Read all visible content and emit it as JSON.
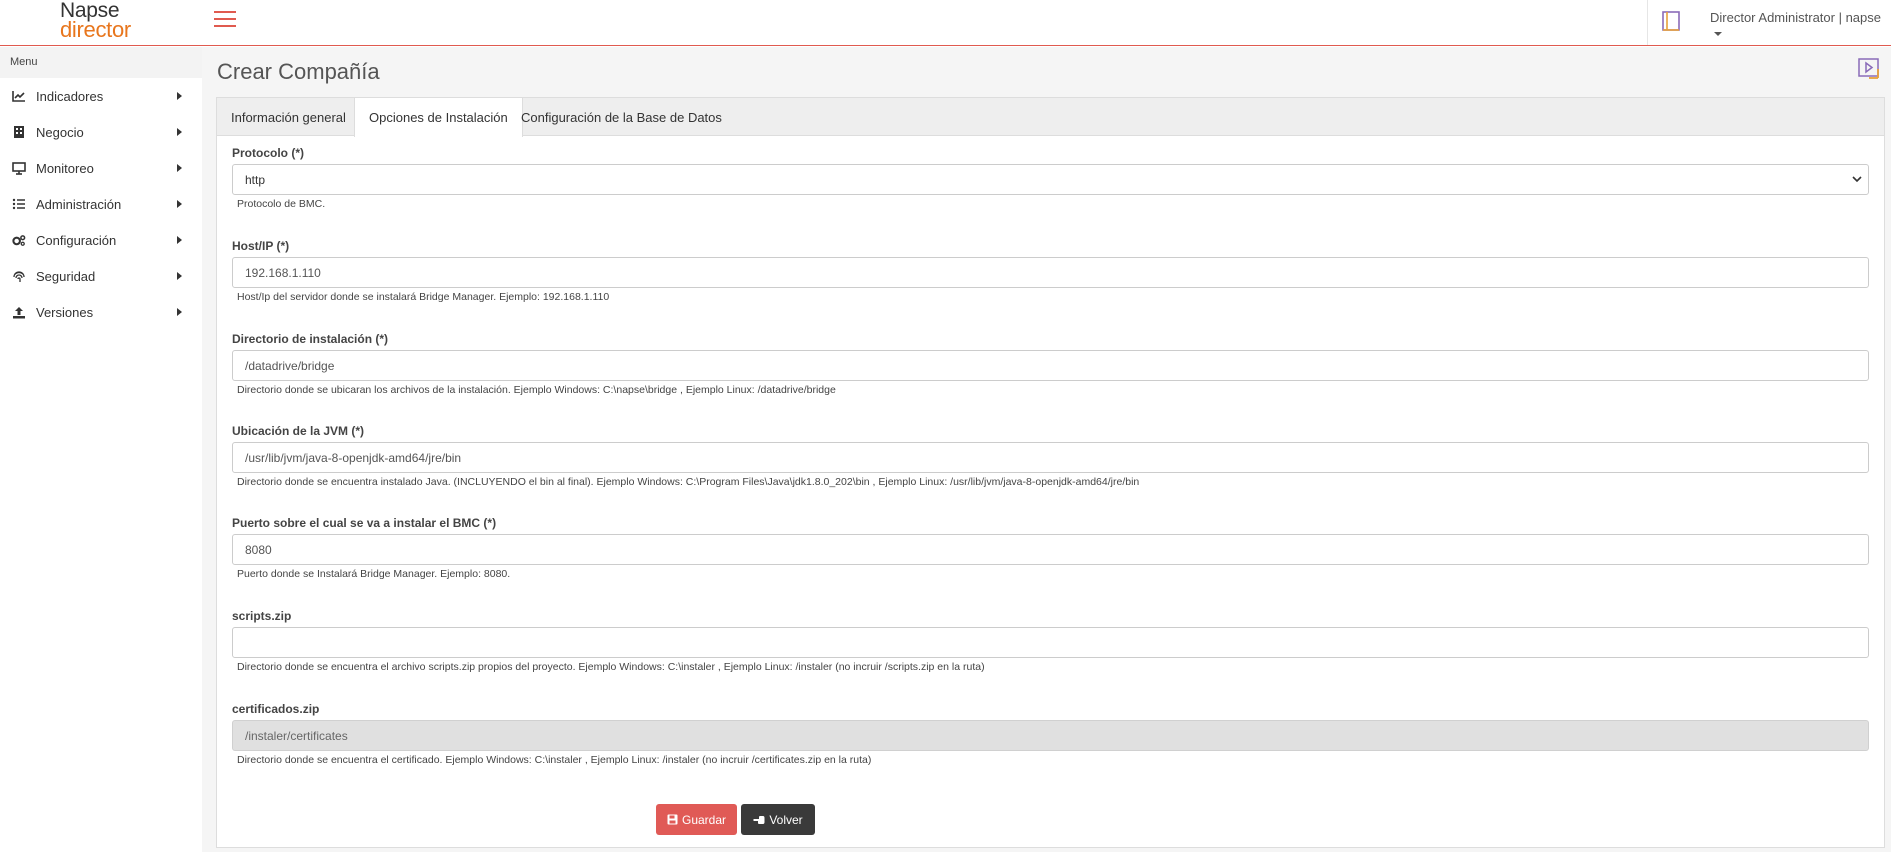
{
  "header": {
    "logo_line1": "Napse",
    "logo_line2": "director",
    "user": "Director Administrator | napse"
  },
  "sidebar": {
    "title": "Menu",
    "items": [
      {
        "label": "Indicadores",
        "icon": "chart-line-icon"
      },
      {
        "label": "Negocio",
        "icon": "building-icon"
      },
      {
        "label": "Monitoreo",
        "icon": "monitor-icon"
      },
      {
        "label": "Administración",
        "icon": "list-icon"
      },
      {
        "label": "Configuración",
        "icon": "cogs-icon"
      },
      {
        "label": "Seguridad",
        "icon": "fingerprint-icon"
      },
      {
        "label": "Versiones",
        "icon": "upload-icon"
      }
    ]
  },
  "page": {
    "title": "Crear Compañía",
    "tabs": [
      {
        "label": "Información general",
        "active": false
      },
      {
        "label": "Opciones de Instalación",
        "active": true
      },
      {
        "label": "Configuración de la Base de Datos",
        "active": false
      }
    ]
  },
  "form": {
    "protocol": {
      "label": "Protocolo (*)",
      "value": "http",
      "help": "Protocolo de BMC."
    },
    "host": {
      "label": "Host/IP (*)",
      "value": "192.168.1.110",
      "help": "Host/Ip del servidor donde se instalará Bridge Manager. Ejemplo: 192.168.1.110"
    },
    "install_dir": {
      "label": "Directorio de instalación (*)",
      "value": "/datadrive/bridge",
      "help": "Directorio donde se ubicaran los archivos de la instalación. Ejemplo Windows: C:\\napse\\bridge , Ejemplo Linux: /datadrive/bridge"
    },
    "jvm": {
      "label": "Ubicación de la JVM (*)",
      "value": "/usr/lib/jvm/java-8-openjdk-amd64/jre/bin",
      "help": "Directorio donde se encuentra instalado Java. (INCLUYENDO el bin al final). Ejemplo Windows: C:\\Program Files\\Java\\jdk1.8.0_202\\bin , Ejemplo Linux: /usr/lib/jvm/java-8-openjdk-amd64/jre/bin"
    },
    "port": {
      "label": "Puerto sobre el cual se va a instalar el BMC (*)",
      "value": "8080",
      "help": "Puerto donde se Instalará Bridge Manager. Ejemplo: 8080."
    },
    "scripts": {
      "label": "scripts.zip",
      "value": "",
      "help": "Directorio donde se encuentra el archivo scripts.zip propios del proyecto. Ejemplo Windows: C:\\instaler , Ejemplo Linux: /instaler (no incruir /scripts.zip en la ruta)"
    },
    "certificates": {
      "label": "certificados.zip",
      "value": "/instaler/certificates",
      "help": "Directorio donde se encuentra el certificado. Ejemplo Windows: C:\\instaler , Ejemplo Linux: /instaler (no incruir /certificates.zip en la ruta)"
    },
    "save_label": "Guardar",
    "back_label": "Volver"
  },
  "colors": {
    "accent": "#e05a4f",
    "logo_orange": "#e8761d",
    "save_button": "#e05a56",
    "back_button": "#3a3a3a"
  }
}
